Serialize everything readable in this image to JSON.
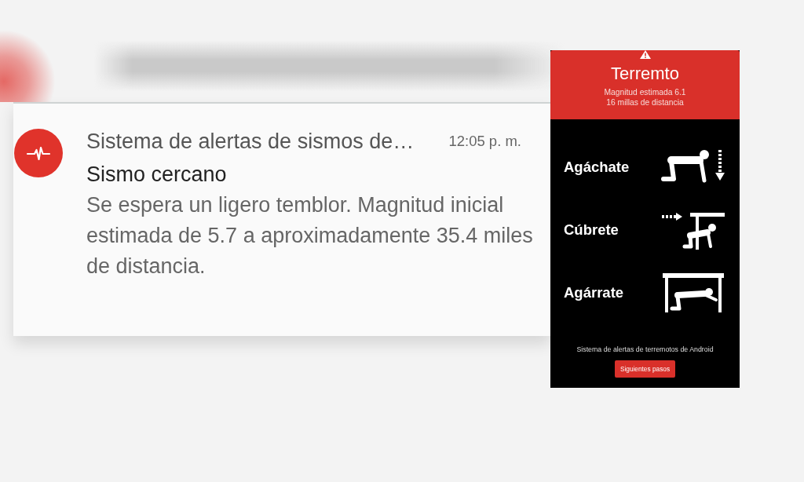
{
  "notification": {
    "app_name": "Sistema de alertas de sismos de…",
    "time": "12:05 p. m.",
    "title": "Sismo cercano",
    "body": "Se espera un ligero temblor. Magnitud inicial estimada de 5.7 a aproximadamente 35.4 miles de distancia."
  },
  "alert_screen": {
    "title": "Terremto",
    "details": [
      "Magnitud estimada 6.1",
      "16 millas de distancia"
    ],
    "steps": [
      {
        "label": "Agáchate",
        "kind": "drop"
      },
      {
        "label": "Cúbrete",
        "kind": "cover"
      },
      {
        "label": "Agárrate",
        "kind": "hold"
      }
    ],
    "footer": "Sistema de alertas de terremotos de Android",
    "button": "Siguientes pasos"
  }
}
